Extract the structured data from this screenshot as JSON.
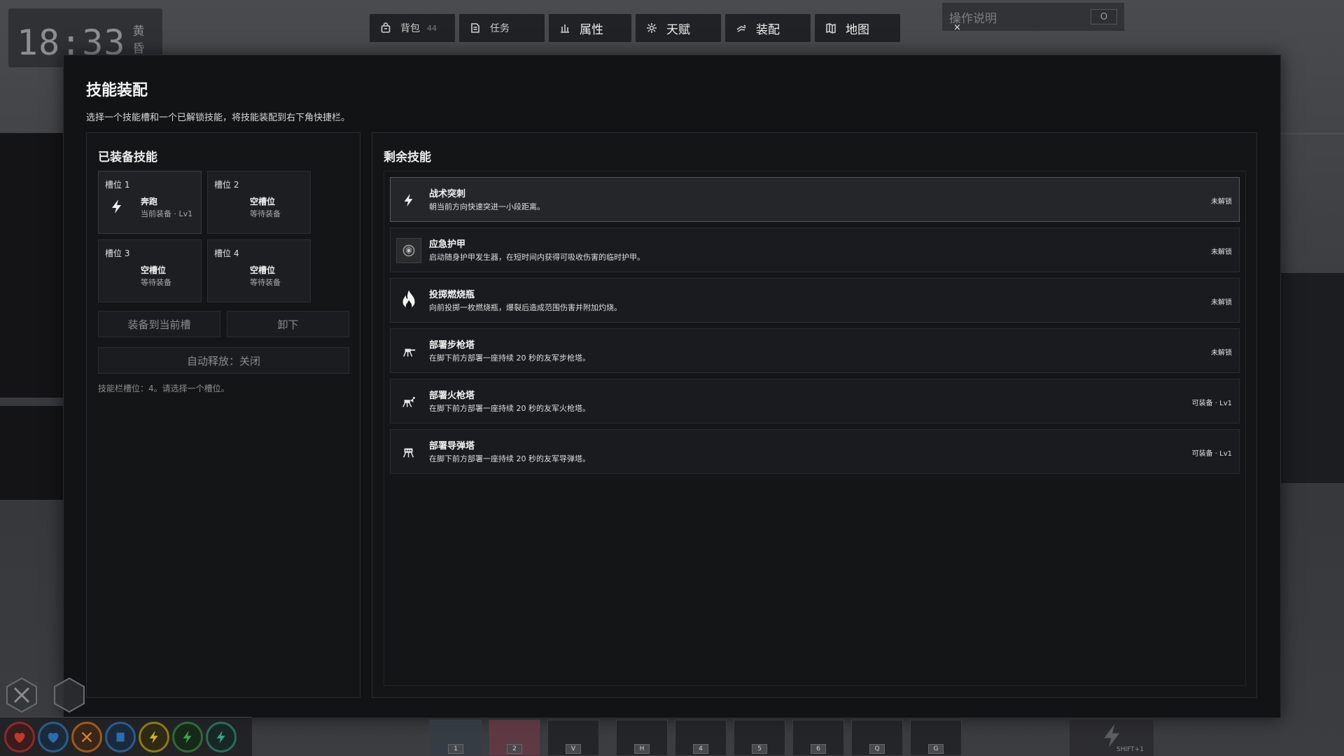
{
  "clock": {
    "time": "18:33",
    "phase": "黄昏"
  },
  "nav": {
    "tabs": [
      {
        "label": "背包",
        "count": "44",
        "icon": "bag-icon"
      },
      {
        "label": "任务",
        "icon": "quest-icon"
      },
      {
        "label": "属性",
        "icon": "stats-icon"
      },
      {
        "label": "天赋",
        "icon": "talent-icon"
      },
      {
        "label": "装配",
        "icon": "loadout-icon"
      },
      {
        "label": "地图",
        "icon": "map-icon"
      }
    ]
  },
  "help": {
    "title": "操作说明",
    "key": "O",
    "close": "×"
  },
  "modal": {
    "title": "技能装配",
    "description": "选择一个技能槽和一个已解锁技能，将技能装配到右下角快捷栏。",
    "equipped": {
      "title": "已装备技能",
      "slots": [
        {
          "label": "槽位 1",
          "name": "奔跑",
          "sub": "当前装备 · Lv1",
          "icon": "lightning-icon"
        },
        {
          "label": "槽位 2",
          "name": "空槽位",
          "sub": "等待装备"
        },
        {
          "label": "槽位 3",
          "name": "空槽位",
          "sub": "等待装备"
        },
        {
          "label": "槽位 4",
          "name": "空槽位",
          "sub": "等待装备"
        }
      ],
      "equip_button": "装备到当前槽",
      "unequip_button": "卸下",
      "auto_release_button": "自动释放：关闭",
      "hint": "技能栏槽位：4。请选择一个槽位。"
    },
    "remaining": {
      "title": "剩余技能",
      "skills": [
        {
          "name": "战术突刺",
          "desc": "朝当前方向快速突进一小段距离。",
          "status": "未解锁",
          "icon": "lightning-icon"
        },
        {
          "name": "应急护甲",
          "desc": "启动随身护甲发生器，在短时间内获得可吸收伤害的临时护甲。",
          "status": "未解锁",
          "icon": "armor-icon"
        },
        {
          "name": "投掷燃烧瓶",
          "desc": "向前投掷一枚燃烧瓶，爆裂后造成范围伤害并附加灼烧。",
          "status": "未解锁",
          "icon": "fire-icon"
        },
        {
          "name": "部署步枪塔",
          "desc": "在脚下前方部署一座持续 20 秒的友军步枪塔。",
          "status": "未解锁",
          "icon": "turret-icon"
        },
        {
          "name": "部署火枪塔",
          "desc": "在脚下前方部署一座持续 20 秒的友军火枪塔。",
          "status": "可装备 · Lv1",
          "icon": "flame-turret-icon"
        },
        {
          "name": "部署导弹塔",
          "desc": "在脚下前方部署一座持续 20 秒的友军导弹塔。",
          "status": "可装备 · Lv1",
          "icon": "missile-turret-icon"
        }
      ]
    }
  },
  "hotbar": {
    "keys": [
      "1",
      "2",
      "V",
      "H",
      "4",
      "5",
      "6",
      "Q",
      "G"
    ],
    "shift_hint": "SHIFT+1"
  },
  "colors": {
    "modal_bg": "#121315",
    "panel_bg": "#141517",
    "active_row": "#24262a",
    "accent_green": "#3fa04a",
    "accent_red": "#c0392b",
    "accent_blue": "#2b6cb0",
    "accent_orange": "#d9822b",
    "accent_yellow": "#c9b12a"
  }
}
